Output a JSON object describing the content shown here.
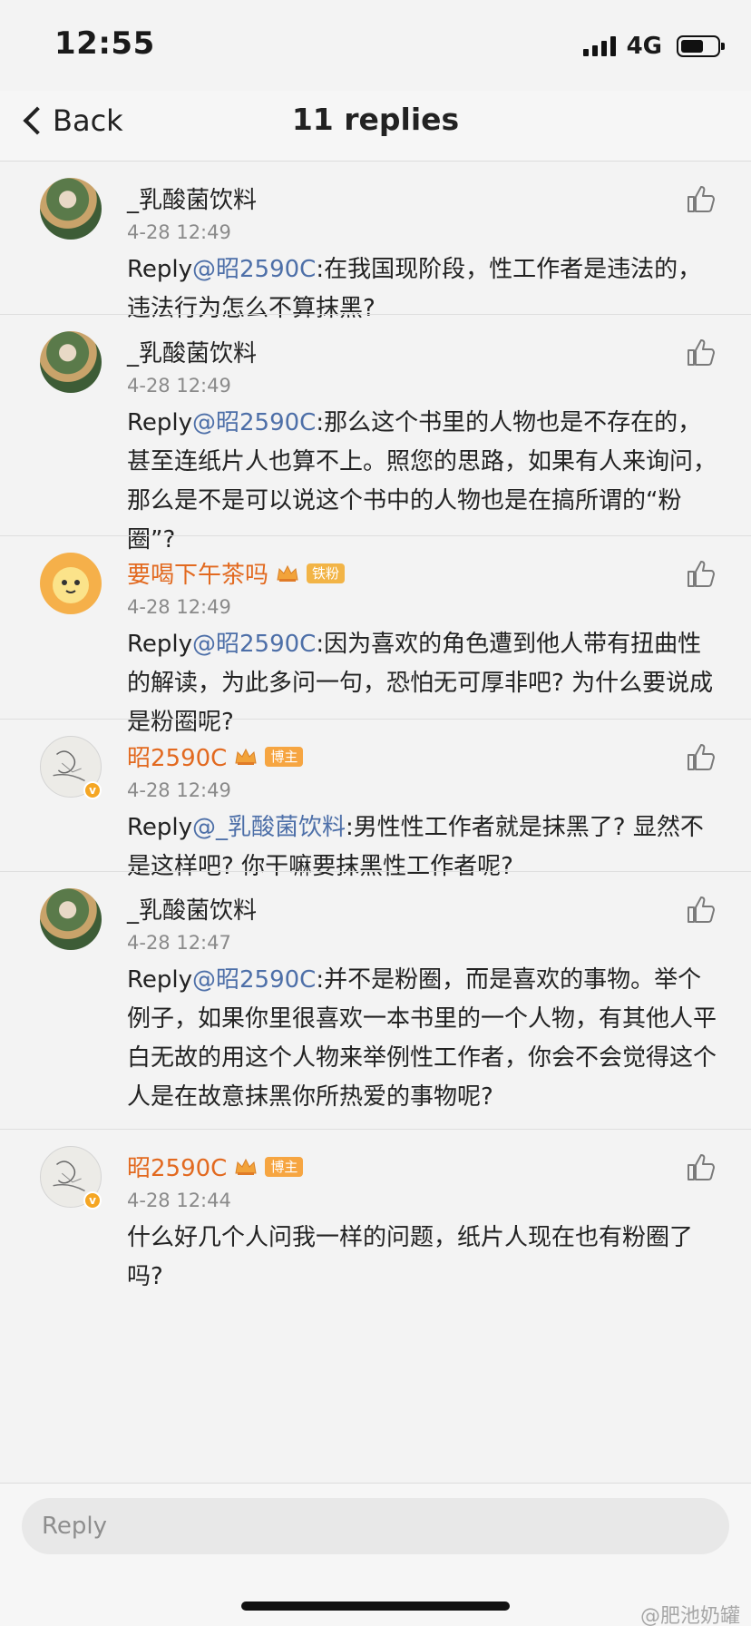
{
  "status_bar": {
    "time": "12:55",
    "network": "4G",
    "battery_fraction": 0.62
  },
  "nav": {
    "back_label": "Back",
    "title": "11 replies"
  },
  "colors": {
    "mention": "#4d6fa8",
    "vip_name": "#e2691f",
    "badge": "#f6a541"
  },
  "comments": [
    {
      "username": "_乳酸菌饮料",
      "timestamp": "4-28 12:49",
      "reply_prefix": "Reply",
      "mention": "@昭2590C",
      "text": ":在我国现阶段，性工作者是违法的，违法行为怎么不算抹黑?"
    },
    {
      "username": "_乳酸菌饮料",
      "timestamp": "4-28 12:49",
      "reply_prefix": "Reply",
      "mention": "@昭2590C",
      "text": ":那么这个书里的人物也是不存在的，甚至连纸片人也算不上。照您的思路，如果有人来询问，那么是不是可以说这个书中的人物也是在搞所谓的“粉圈”?"
    },
    {
      "username": "要喝下午茶吗",
      "badge": "铁粉",
      "timestamp": "4-28 12:49",
      "reply_prefix": "Reply",
      "mention": "@昭2590C",
      "text": ":因为喜欢的角色遭到他人带有扭曲性的解读，为此多问一句，恐怕无可厚非吧? 为什么要说成是粉圈呢?"
    },
    {
      "username": "昭2590C",
      "badge": "博主",
      "timestamp": "4-28 12:49",
      "reply_prefix": "Reply",
      "mention": "@_乳酸菌饮料",
      "text": ":男性性工作者就是抹黑了? 显然不是这样吧? 你干嘛要抹黑性工作者呢?"
    },
    {
      "username": "_乳酸菌饮料",
      "timestamp": "4-28 12:47",
      "reply_prefix": "Reply",
      "mention": "@昭2590C",
      "text": ":并不是粉圈，而是喜欢的事物。举个例子，如果你里很喜欢一本书里的一个人物，有其他人平白无故的用这个人物来举例性工作者，你会不会觉得这个人是在故意抹黑你所热爱的事物呢?"
    },
    {
      "username": "昭2590C",
      "badge": "博主",
      "timestamp": "4-28 12:44",
      "text": "什么好几个人问我一样的问题，纸片人现在也有粉圈了吗?"
    }
  ],
  "reply_bar": {
    "placeholder": "Reply",
    "watermark": "@肥池奶罐"
  }
}
